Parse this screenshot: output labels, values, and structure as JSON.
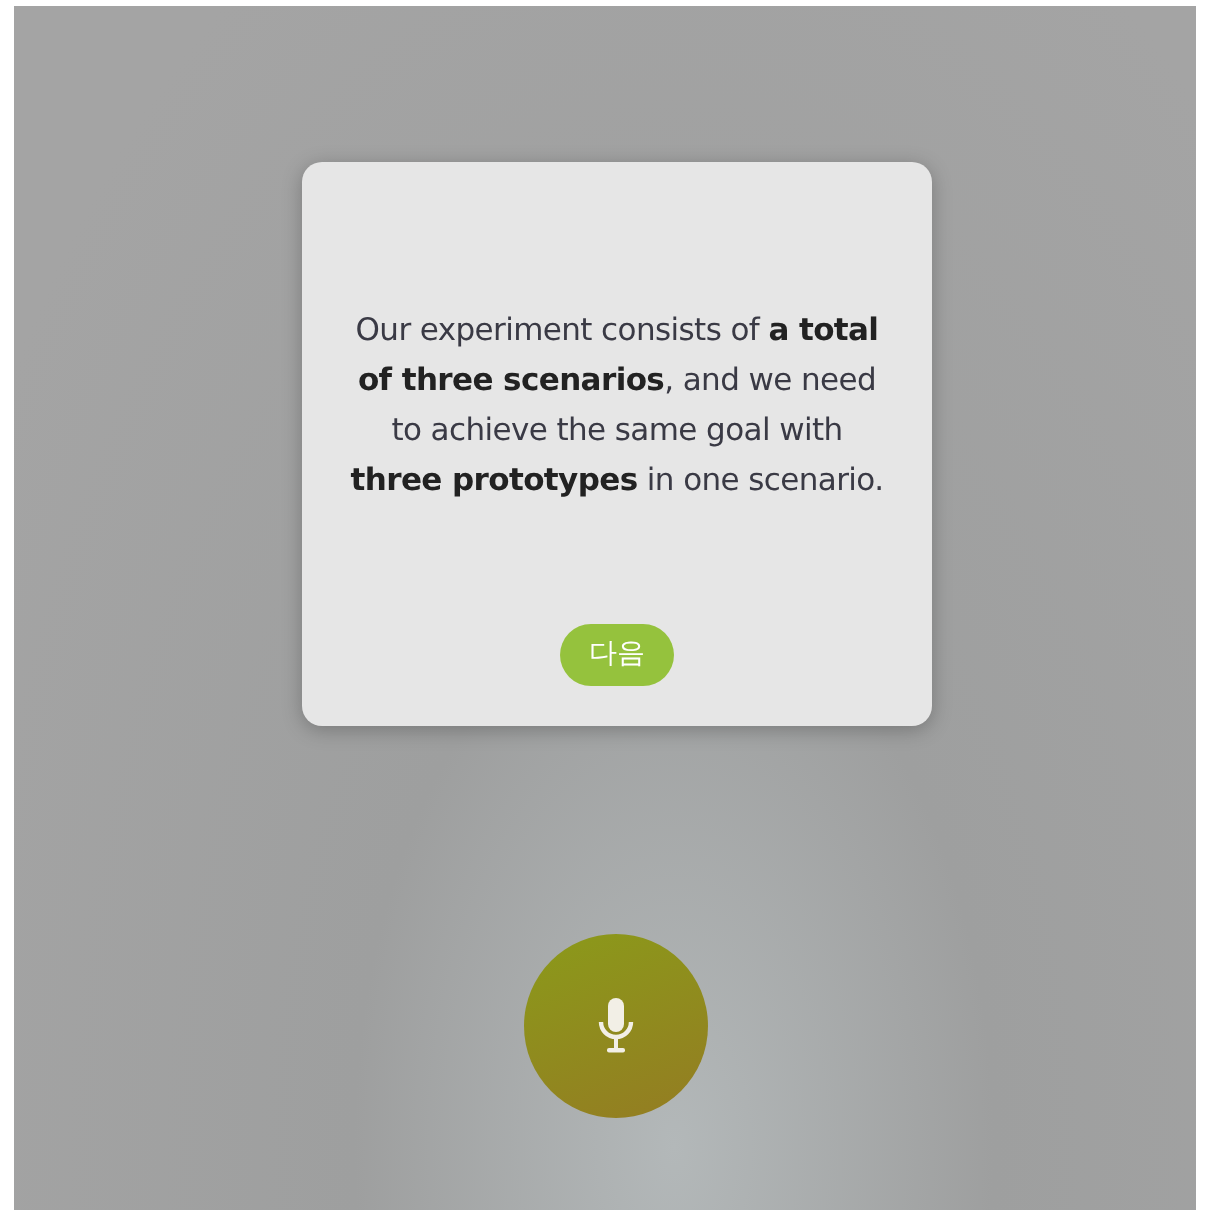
{
  "dialog": {
    "message": "Our experiment consists of **a total of three scenarios**, and we need to achieve the same goal with **three prototypes** in one scenario.",
    "button": "다음"
  }
}
